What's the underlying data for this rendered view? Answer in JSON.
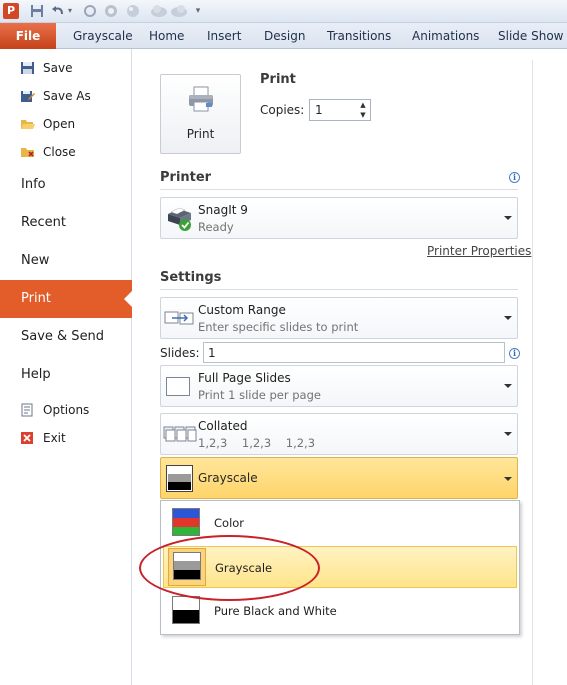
{
  "qat": {
    "logo_letter": "P",
    "icons": [
      "save-icon",
      "undo-icon",
      "undo-dropdown-icon",
      "redo-icon",
      "repeat-icon",
      "clear-icon",
      "cloud-icon",
      "cloud-icon",
      "customize-qat-icon"
    ]
  },
  "ribbon": {
    "file_tab": "File",
    "tabs": [
      "Grayscale",
      "Home",
      "Insert",
      "Design",
      "Transitions",
      "Animations",
      "Slide Show"
    ],
    "file_color": "#d24726"
  },
  "nav": {
    "save": "Save",
    "save_as": "Save As",
    "open": "Open",
    "close": "Close",
    "info": "Info",
    "recent": "Recent",
    "new": "New",
    "print": "Print",
    "save_send": "Save & Send",
    "help": "Help",
    "options": "Options",
    "exit": "Exit",
    "active_color": "#e35d2a"
  },
  "print_section": {
    "button_label": "Print",
    "heading": "Print",
    "copies_label": "Copies:",
    "copies_value": "1"
  },
  "printer": {
    "heading": "Printer",
    "name": "SnagIt 9",
    "status": "Ready",
    "properties_link": "Printer Properties"
  },
  "settings": {
    "heading": "Settings",
    "range": {
      "title": "Custom Range",
      "subtitle": "Enter specific slides to print"
    },
    "slides_label": "Slides:",
    "slides_value": "1",
    "layout": {
      "title": "Full Page Slides",
      "subtitle": "Print 1 slide per page"
    },
    "collation": {
      "title": "Collated",
      "subtitle": "1,2,3    1,2,3    1,2,3"
    },
    "color_mode": {
      "selected": "Grayscale"
    }
  },
  "color_menu": {
    "items": [
      "Color",
      "Grayscale",
      "Pure Black and White"
    ],
    "highlighted_index": 1,
    "highlight_color": "#ffe48a"
  },
  "annotation": {
    "shape": "ellipse",
    "color": "#c6222a"
  }
}
